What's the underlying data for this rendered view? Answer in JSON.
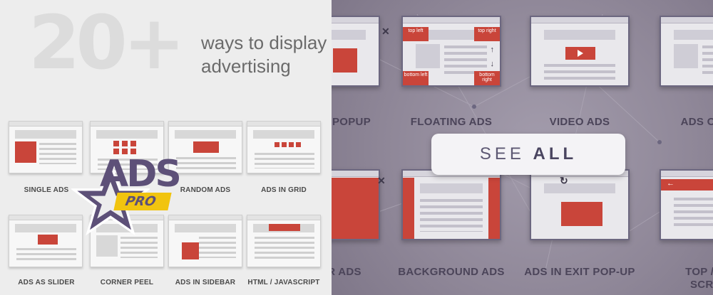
{
  "hero": {
    "number": "20+",
    "tagline_line1": "ways to display",
    "tagline_line2": "advertising"
  },
  "logo": {
    "word": "ADS",
    "badge": "PRO"
  },
  "left_grid": [
    {
      "label": "SINGLE ADS"
    },
    {
      "label": ""
    },
    {
      "label": "RANDOM ADS"
    },
    {
      "label": "ADS IN GRID"
    },
    {
      "label": "ADS AS SLIDER"
    },
    {
      "label": "CORNER PEEL"
    },
    {
      "label": "ADS IN SIDEBAR"
    },
    {
      "label": "HTML / JAVASCRIPT"
    }
  ],
  "right_grid": [
    {
      "label": "POPUP"
    },
    {
      "label": "FLOATING ADS"
    },
    {
      "label": "VIDEO ADS"
    },
    {
      "label": "ADS OVER"
    },
    {
      "label": "R ADS"
    },
    {
      "label": "BACKGROUND ADS"
    },
    {
      "label": "ADS IN EXIT POP-UP"
    },
    {
      "label": "TOP / BO"
    },
    {
      "label": "SCROL"
    }
  ],
  "floating_corners": {
    "tl": "top left",
    "tr": "top right",
    "bl": "bottom left",
    "br": "bottom right"
  },
  "cta": {
    "see": "SEE",
    "all": "ALL"
  },
  "colors": {
    "accent_red": "#c9453a",
    "brand_purple": "#5d5078",
    "brand_yellow": "#f1c40f"
  }
}
